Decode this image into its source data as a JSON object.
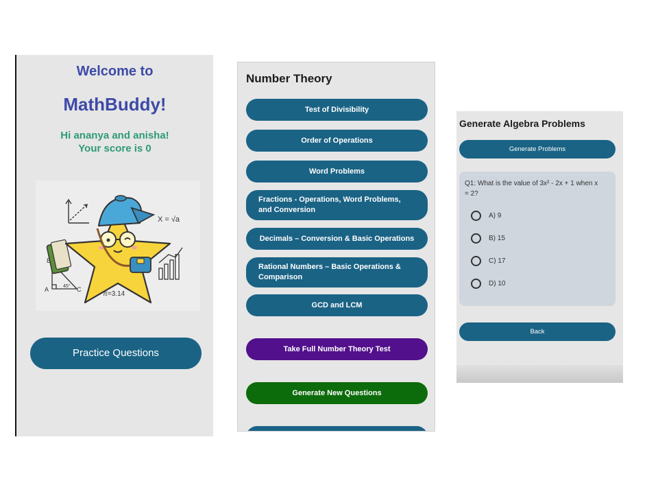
{
  "screen1": {
    "welcome": "Welcome to",
    "app_name": "MathBuddy!",
    "greeting_line1": "Hi ananya and anisha!",
    "greeting_line2": "Your score is 0",
    "mascot_formula1": "X = √a",
    "mascot_formula2": "π=3.14",
    "mascot_label_b": "B",
    "mascot_label_a": "A",
    "mascot_label_c": "C",
    "mascot_angle": "45°",
    "practice_button": "Practice Questions"
  },
  "screen2": {
    "title": "Number Theory",
    "topics": [
      "Test of Divisibility",
      "Order of Operations",
      "Word Problems",
      "Fractions - Operations, Word Problems, and Conversion",
      "Decimals – Conversion & Basic Operations",
      "Rational Numbers – Basic Operations & Comparison",
      "GCD and LCM"
    ],
    "full_test_button": "Take Full Number Theory Test",
    "generate_new_button": "Generate New Questions"
  },
  "screen3": {
    "title": "Generate Algebra Problems",
    "generate_button": "Generate Problems",
    "question": "Q1: What is the value of 3x² - 2x + 1 when x = 2?",
    "options": [
      "A) 9",
      "B) 15",
      "C) 17",
      "D) 10"
    ],
    "back_button": "Back"
  },
  "colors": {
    "primary_button": "#1a6385",
    "purple_button": "#52108c",
    "green_button": "#0c6b0a",
    "heading_blue": "#3d4aa8",
    "greeting_green": "#2f9a76"
  }
}
